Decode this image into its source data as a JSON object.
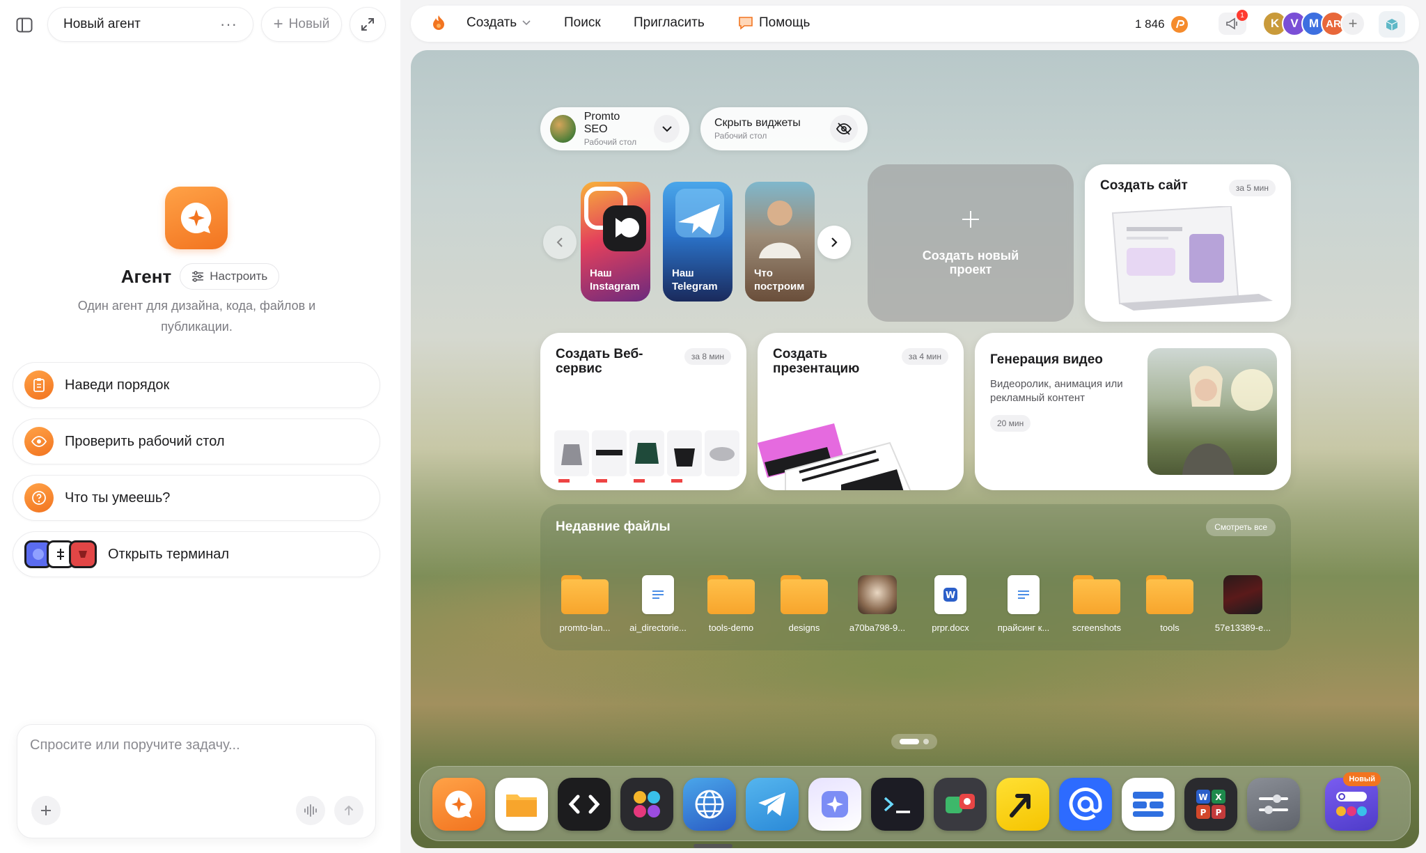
{
  "left_panel": {
    "chat_title": "Новый агент",
    "new_label": "Новый",
    "agent": {
      "name": "Агент",
      "configure_label": "Настроить",
      "description": "Один агент для дизайна, кода, файлов и публикации."
    },
    "suggestions": [
      {
        "label": "Наведи порядок",
        "icon": "clipboard-icon"
      },
      {
        "label": "Проверить рабочий стол",
        "icon": "eye-icon"
      },
      {
        "label": "Что ты умеешь?",
        "icon": "question-icon"
      },
      {
        "label": "Открыть терминал",
        "icon": "terminal-apps-icon"
      }
    ],
    "composer": {
      "placeholder": "Спросите или поручите задачу..."
    }
  },
  "topbar": {
    "nav": [
      "Создать",
      "Поиск",
      "Пригласить",
      "Помощь"
    ],
    "credits": "1 846",
    "notification_count": "1",
    "avatars": [
      {
        "initial": "K",
        "color": "#c99a3a"
      },
      {
        "initial": "V",
        "color": "#7a4fd6"
      },
      {
        "initial": "M",
        "color": "#3d6fe0"
      },
      {
        "initial": "AR",
        "color": "#e8673a"
      }
    ]
  },
  "desktop": {
    "workspace": {
      "name": "Promto SEO",
      "sub": "Рабочий стол"
    },
    "widgets_toggle": {
      "name": "Скрыть виджеты",
      "sub": "Рабочий стол"
    },
    "app_tiles": [
      {
        "label": "Наш Instagram"
      },
      {
        "label": "Наш Telegram"
      },
      {
        "label": "Что построим"
      }
    ],
    "create_project": "Создать новый проект",
    "cards": {
      "site": {
        "title": "Создать сайт",
        "tag": "за 5 мин"
      },
      "webservice": {
        "title": "Создать Веб-сервис",
        "tag": "за 8 мин"
      },
      "presentation": {
        "title": "Создать презентацию",
        "tag": "за 4 мин"
      },
      "video": {
        "title": "Генерация видео",
        "desc": "Видеоролик, анимация или рекламный контент",
        "tag": "20 мин"
      }
    },
    "recent": {
      "title": "Недавние файлы",
      "see_all": "Смотреть все",
      "files": [
        {
          "name": "promto-lan...",
          "kind": "folder"
        },
        {
          "name": "ai_directorie...",
          "kind": "doc"
        },
        {
          "name": "tools-demo",
          "kind": "folder"
        },
        {
          "name": "designs",
          "kind": "folder"
        },
        {
          "name": "a70ba798-9...",
          "kind": "image"
        },
        {
          "name": "prpr.docx",
          "kind": "word"
        },
        {
          "name": "прайсинг к...",
          "kind": "doc"
        },
        {
          "name": "screenshots",
          "kind": "folder"
        },
        {
          "name": "tools",
          "kind": "folder"
        },
        {
          "name": "57e13389-e...",
          "kind": "image-dark"
        }
      ]
    },
    "dock": {
      "new_badge": "Новый",
      "apps": [
        "agent-app",
        "files-app",
        "code-app",
        "design-app",
        "browser-app",
        "telegram-app",
        "ai-builder-app",
        "terminal-app",
        "media-app",
        "yandex-app",
        "mail-app",
        "docs-app",
        "office-app",
        "settings-app",
        "launcher-app"
      ]
    }
  }
}
